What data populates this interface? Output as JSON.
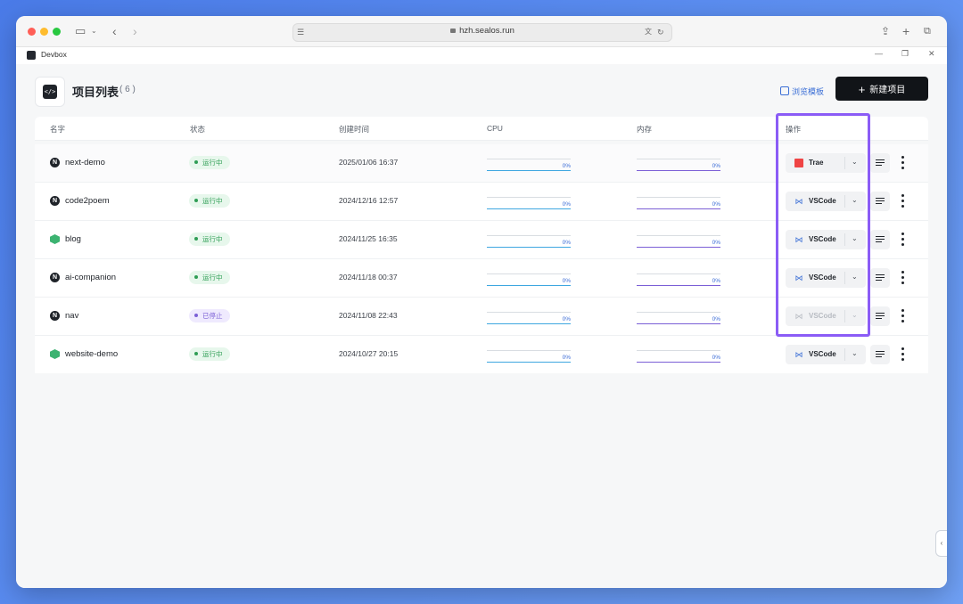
{
  "browser": {
    "url": "hzh.sealos.run"
  },
  "app": {
    "name": "Devbox"
  },
  "header": {
    "title": "项目列表",
    "count": "( 6 )",
    "browse_templates": "浏览模板",
    "new_project": "新建项目"
  },
  "table": {
    "columns": [
      "名字",
      "状态",
      "创建时间",
      "CPU",
      "内存",
      "操作"
    ],
    "rows": [
      {
        "name": "next-demo",
        "icon": "nextjs-icon",
        "status": "运行中",
        "created": "2025/01/06 16:37",
        "cpu": "0%",
        "mem": "0%",
        "ide": "Trae"
      },
      {
        "name": "code2poem",
        "icon": "nextjs-icon",
        "status": "运行中",
        "created": "2024/12/16 12:57",
        "cpu": "0%",
        "mem": "0%",
        "ide": "VSCode"
      },
      {
        "name": "blog",
        "icon": "nodejs-icon",
        "status": "运行中",
        "created": "2024/11/25 16:35",
        "cpu": "0%",
        "mem": "0%",
        "ide": "VSCode"
      },
      {
        "name": "ai-companion",
        "icon": "nextjs-icon",
        "status": "运行中",
        "created": "2024/11/18 00:37",
        "cpu": "0%",
        "mem": "0%",
        "ide": "VSCode"
      },
      {
        "name": "nav",
        "icon": "nextjs-icon",
        "status": "已停止",
        "created": "2024/11/08 22:43",
        "cpu": "0%",
        "mem": "0%",
        "ide": "VSCode"
      },
      {
        "name": "website-demo",
        "icon": "nodejs-icon",
        "status": "运行中",
        "created": "2024/10/27 20:15",
        "cpu": "0%",
        "mem": "0%",
        "ide": "VSCode"
      }
    ]
  },
  "colors": {
    "accent": "#8b5cf6",
    "running": "#2f9e55",
    "stopped": "#7b5fd6",
    "primary_button": "#111418"
  }
}
